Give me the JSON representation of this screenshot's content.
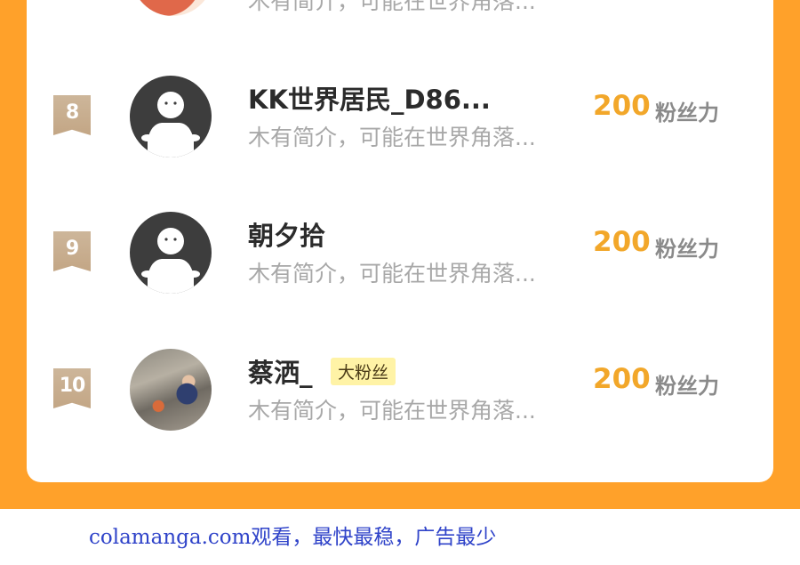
{
  "colors": {
    "frame": "#ffa12a",
    "card": "#ffffff",
    "rank_badge": "#c8ad8e",
    "score": "#f2a72a",
    "fan_badge_bg": "#fff3a6",
    "footer_text": "#2f43c9"
  },
  "partial_row": {
    "avatar": "cartoon-avatar",
    "intro": "木有简介，可能在世界角落..."
  },
  "rows": [
    {
      "rank": "8",
      "avatar": "default-avatar-icon",
      "name": "KK世界居民_D86...",
      "intro": "木有简介，可能在世界角落...",
      "score": "200",
      "score_unit": "粉丝力"
    },
    {
      "rank": "9",
      "avatar": "default-avatar-icon",
      "name": "朝夕拾",
      "intro": "木有简介，可能在世界角落...",
      "score": "200",
      "score_unit": "粉丝力"
    },
    {
      "rank": "10",
      "avatar": "photo-avatar",
      "name": "蔡洒_",
      "badge": "大粉丝",
      "intro": "木有简介，可能在世界角落...",
      "score": "200",
      "score_unit": "粉丝力"
    }
  ],
  "footer": "colamanga.com观看，最快最稳，广告最少"
}
